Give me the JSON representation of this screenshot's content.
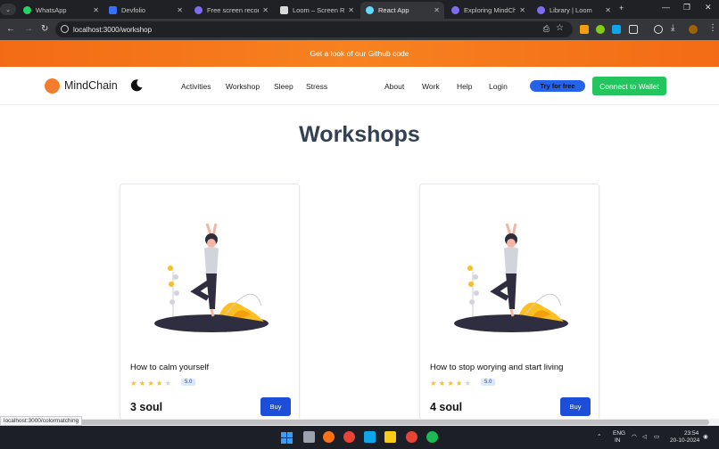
{
  "browser": {
    "tabs": [
      {
        "label": "WhatsApp",
        "favicon_color": "#25d366"
      },
      {
        "label": "Devfolio",
        "favicon_color": "#3770ff"
      },
      {
        "label": "Free screen recorder",
        "favicon_color": "#7c6cf0"
      },
      {
        "label": "Loom – Screen Reco",
        "favicon_color": "#d9d9d9"
      },
      {
        "label": "React App",
        "favicon_color": "#61dafb"
      },
      {
        "label": "Exploring MindChain",
        "favicon_color": "#7c6cf0"
      },
      {
        "label": "Library | Loom",
        "favicon_color": "#7c6cf0"
      }
    ],
    "active_tab": 4,
    "url": "localhost:3000/workshop"
  },
  "banner": {
    "text": "Get a look of our Github code"
  },
  "site": {
    "brand": "MindChain",
    "nav_left": [
      "Activities",
      "Workshop",
      "Sleep",
      "Stress"
    ],
    "nav_right": [
      "About",
      "Work",
      "Help",
      "Login"
    ],
    "try_label": "Try for free",
    "wallet_label": "Connect to Wallet"
  },
  "page": {
    "heading": "Workshops"
  },
  "cards": [
    {
      "title": "How to calm yourself",
      "rating": "5.0",
      "stars_filled": 4,
      "stars_total": 5,
      "price": "3 soul",
      "buy_label": "Buy"
    },
    {
      "title": "How to stop worying and start living",
      "rating": "5.0",
      "stars_filled": 4,
      "stars_total": 5,
      "price": "4 soul",
      "buy_label": "Buy"
    }
  ],
  "status_link": "localhost:3000/colormatching",
  "system": {
    "lang1": "ENG",
    "lang2": "IN",
    "time": "23:54",
    "date": "20-10-2024"
  },
  "colors": {
    "accent_orange": "#f47d2c",
    "primary_blue": "#1d4ed8",
    "wallet_green": "#22c55e"
  }
}
